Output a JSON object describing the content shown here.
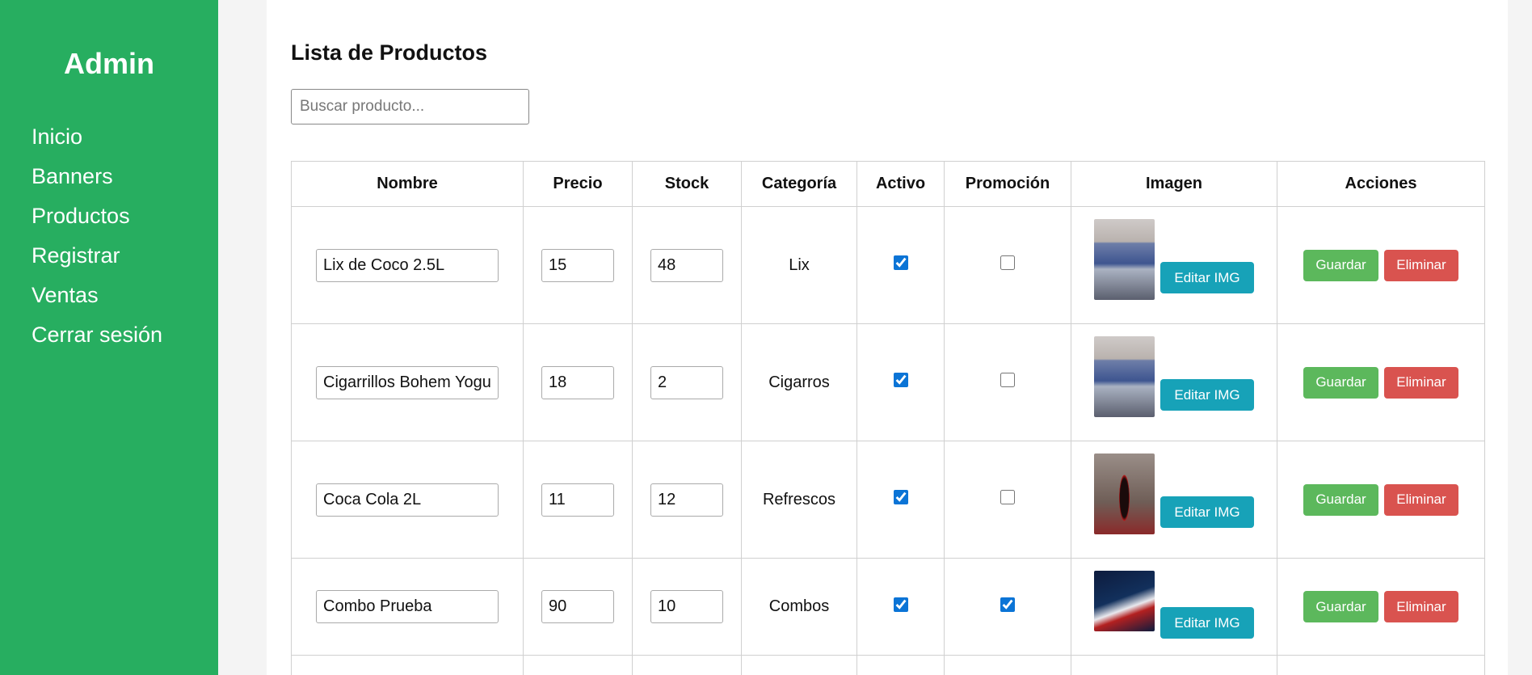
{
  "sidebar": {
    "brand": "Admin",
    "items": [
      {
        "label": "Inicio"
      },
      {
        "label": "Banners"
      },
      {
        "label": "Productos"
      },
      {
        "label": "Registrar"
      },
      {
        "label": "Ventas"
      },
      {
        "label": "Cerrar sesión"
      }
    ]
  },
  "main": {
    "title": "Lista de Productos",
    "search": {
      "placeholder": "Buscar producto...",
      "value": ""
    }
  },
  "table": {
    "headers": [
      "Nombre",
      "Precio",
      "Stock",
      "Categoría",
      "Activo",
      "Promoción",
      "Imagen",
      "Acciones"
    ],
    "edit_img_label": "Editar IMG",
    "save_label": "Guardar",
    "delete_label": "Eliminar",
    "rows": [
      {
        "name": "Lix de Coco 2.5L",
        "price": "15",
        "stock": "48",
        "category": "Lix",
        "active": true,
        "promo": false,
        "image": "cigarette-packs-photo"
      },
      {
        "name": "Cigarrillos Bohem Yogurt",
        "price": "18",
        "stock": "2",
        "category": "Cigarros",
        "active": true,
        "promo": false,
        "image": "cigarette-packs-photo"
      },
      {
        "name": "Coca Cola 2L",
        "price": "11",
        "stock": "12",
        "category": "Refrescos",
        "active": true,
        "promo": false,
        "image": "coke-bottle-photo"
      },
      {
        "name": "Combo Prueba",
        "price": "90",
        "stock": "10",
        "category": "Combos",
        "active": true,
        "promo": true,
        "image": "combo-promo-photo"
      }
    ]
  },
  "colors": {
    "sidebar": "#27ae60",
    "edit": "#17a2b8",
    "save": "#5cb85c",
    "delete": "#d9534f"
  }
}
